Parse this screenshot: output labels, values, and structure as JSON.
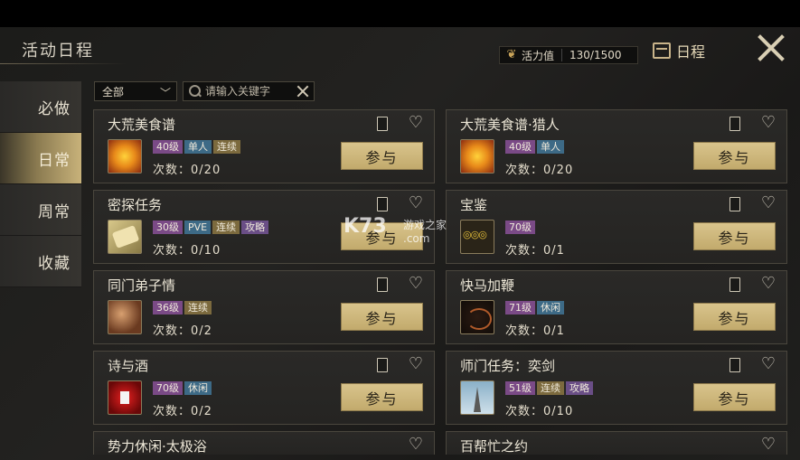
{
  "panel": {
    "title": "活动日程"
  },
  "vitality": {
    "label": "活力值",
    "value": "130/1500",
    "icon": "leaf-icon"
  },
  "schedule_button": {
    "label": "日程",
    "icon": "calendar-icon"
  },
  "sidebar": {
    "items": [
      {
        "label": "必做",
        "active": false
      },
      {
        "label": "日常",
        "active": true
      },
      {
        "label": "周常",
        "active": false
      },
      {
        "label": "收藏",
        "active": false
      }
    ]
  },
  "filter": {
    "selected": "全部"
  },
  "search": {
    "placeholder": "请输入关键字"
  },
  "join_label": "参与",
  "count_prefix": "次数：",
  "activities": [
    {
      "name": "大荒美食谱",
      "tags": [
        "40级",
        "单人",
        "连续"
      ],
      "count": "0/20",
      "icon": "food-icon"
    },
    {
      "name": "大荒美食谱·猎人",
      "tags": [
        "40级",
        "单人"
      ],
      "count": "0/20",
      "icon": "food-icon"
    },
    {
      "name": "密探任务",
      "tags": [
        "30级",
        "PVE",
        "连续",
        "攻略"
      ],
      "count": "0/10",
      "icon": "scroll-icon"
    },
    {
      "name": "宝鉴",
      "tags": [
        "70级"
      ],
      "count": "0/1",
      "icon": "coins-icon"
    },
    {
      "name": "同门弟子情",
      "tags": [
        "36级",
        "连续"
      ],
      "count": "0/2",
      "icon": "couple-icon"
    },
    {
      "name": "快马加鞭",
      "tags": [
        "71级",
        "休闲"
      ],
      "count": "0/1",
      "icon": "whip-icon"
    },
    {
      "name": "诗与酒",
      "tags": [
        "70级",
        "休闲"
      ],
      "count": "0/2",
      "icon": "wine-icon"
    },
    {
      "name": "师门任务：奕剑",
      "tags": [
        "51级",
        "连续",
        "攻略"
      ],
      "count": "0/10",
      "icon": "pagoda-icon"
    },
    {
      "name": "势力休闲·太极浴",
      "partial": true
    },
    {
      "name": "百帮忙之约",
      "partial": true
    }
  ],
  "watermark": {
    "text": "K73",
    "sub": "游戏之家",
    "domain": ".com"
  }
}
